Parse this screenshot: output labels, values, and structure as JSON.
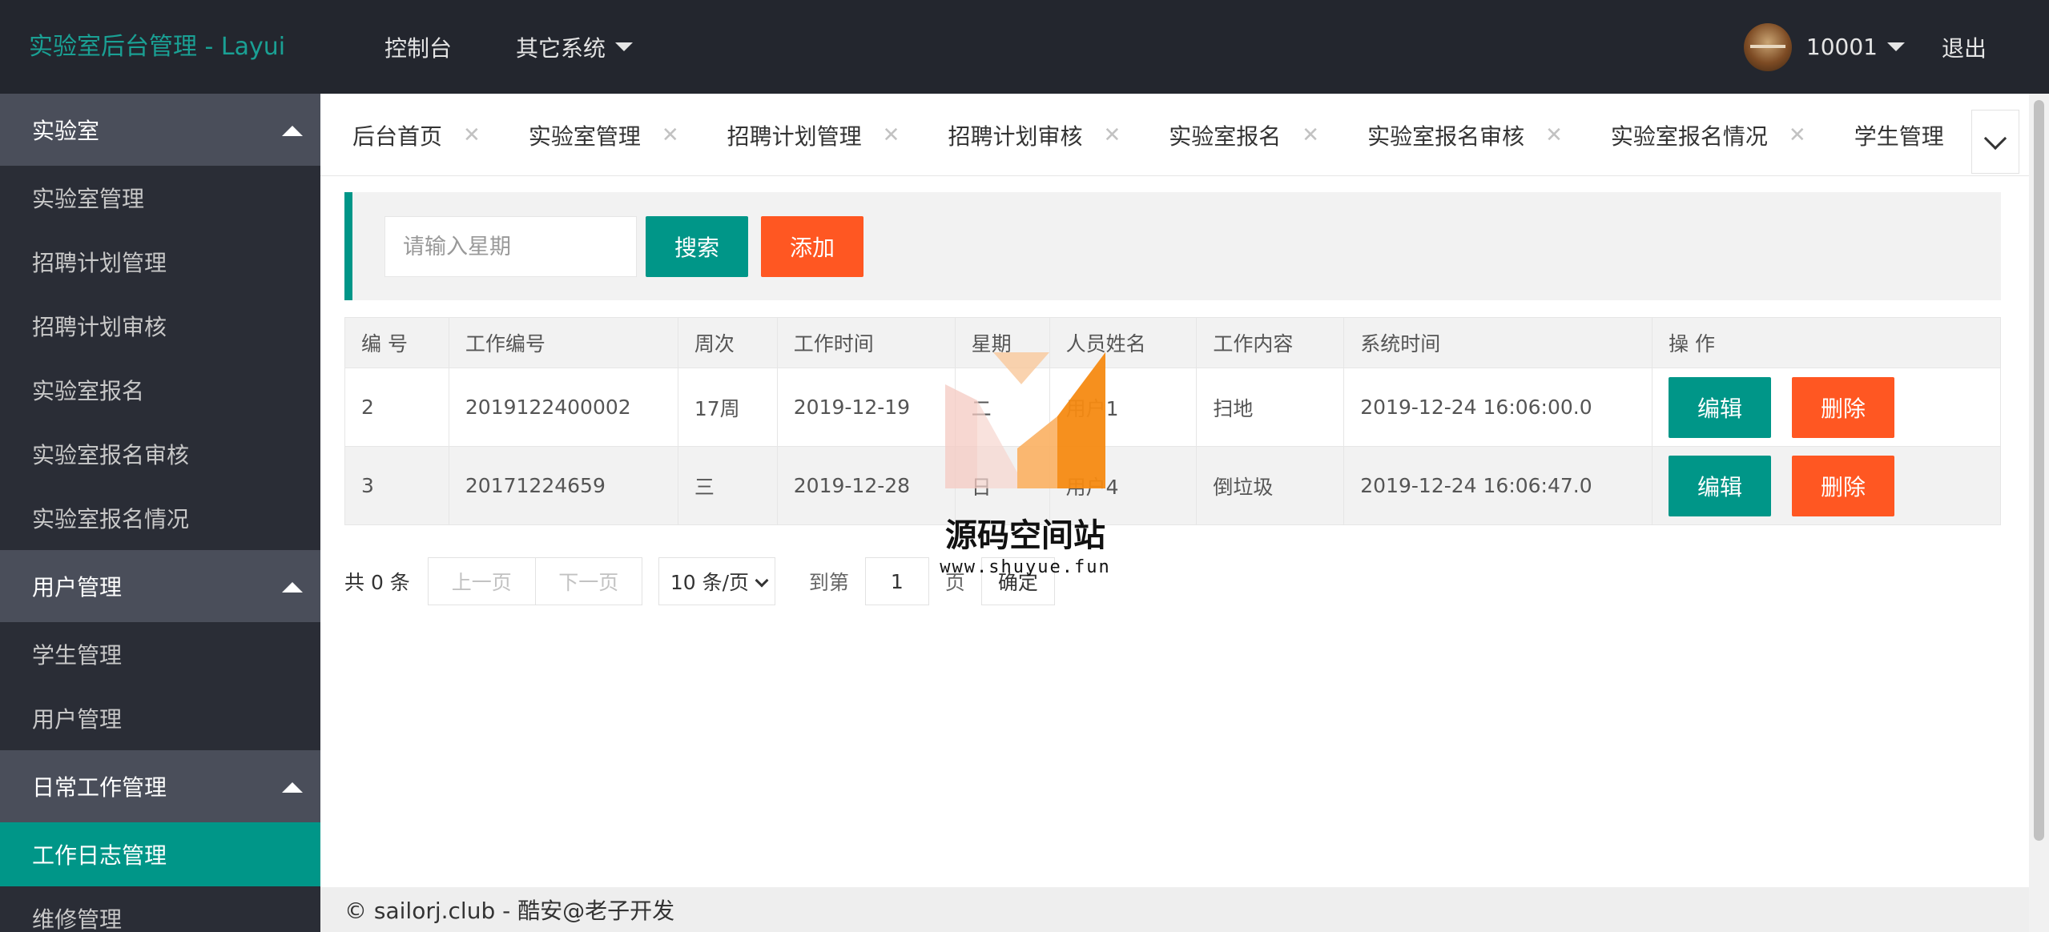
{
  "header": {
    "logo": "实验室后台管理 - Layui",
    "nav": [
      "控制台",
      "其它系统"
    ],
    "user": "10001",
    "logout": "退出"
  },
  "sidebar": {
    "groups": [
      {
        "title": "实验室",
        "items": [
          "实验室管理",
          "招聘计划管理",
          "招聘计划审核",
          "实验室报名",
          "实验室报名审核",
          "实验室报名情况"
        ]
      },
      {
        "title": "用户管理",
        "items": [
          "学生管理",
          "用户管理"
        ]
      },
      {
        "title": "日常工作管理",
        "items": [
          "工作日志管理",
          "维修管理"
        ]
      }
    ],
    "active_item": "工作日志管理"
  },
  "tabs": [
    "后台首页",
    "实验室管理",
    "招聘计划管理",
    "招聘计划审核",
    "实验室报名",
    "实验室报名审核",
    "实验室报名情况",
    "学生管理"
  ],
  "search": {
    "placeholder": "请输入星期",
    "search_label": "搜索",
    "add_label": "添加"
  },
  "table": {
    "columns": [
      "编 号",
      "工作编号",
      "周次",
      "工作时间",
      "星期",
      "人员姓名",
      "工作内容",
      "系统时间",
      "操 作"
    ],
    "rows": [
      [
        "2",
        "2019122400002",
        "17周",
        "2019-12-19",
        "二",
        "用户1",
        "扫地",
        "2019-12-24 16:06:00.0"
      ],
      [
        "3",
        "20171224659",
        "三",
        "2019-12-28",
        "日",
        "用户4",
        "倒垃圾",
        "2019-12-24 16:06:47.0"
      ]
    ],
    "edit_label": "编辑",
    "delete_label": "删除"
  },
  "pager": {
    "total": "共 0 条",
    "prev": "上一页",
    "next": "下一页",
    "limit": "10 条/页",
    "goto": "到第",
    "page": "1",
    "page_unit": "页",
    "confirm": "确定"
  },
  "watermark": {
    "text": "源码空间站",
    "url": "www.shuyue.fun"
  },
  "footer": "© sailorj.club - 酷安@老子开发",
  "colors": {
    "header_bg": "#23262e",
    "sidebar_bg": "#393d49",
    "primary": "#009688",
    "danger": "#ff5722",
    "logo": "#1aa094"
  }
}
